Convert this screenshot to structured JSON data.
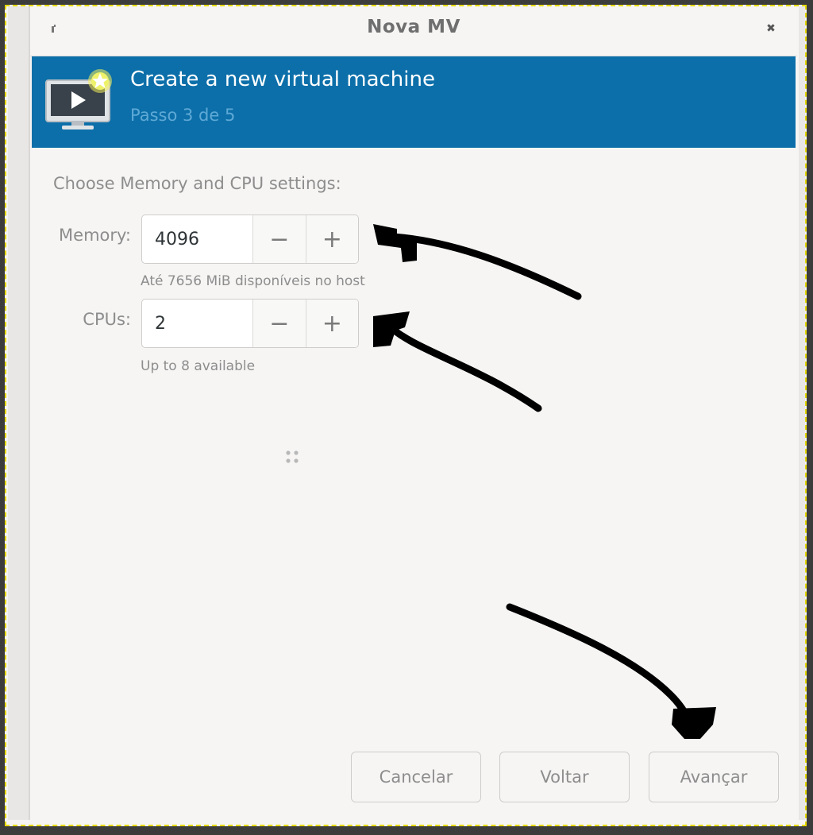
{
  "window": {
    "title": "Nova MV",
    "close_glyph": "✖"
  },
  "banner": {
    "title": "Create a new virtual machine",
    "step": "Passo 3 de 5",
    "icon": "vm-monitor-new-icon",
    "background": "#0c6fa9"
  },
  "content": {
    "section_title": "Choose Memory and CPU settings:",
    "memory": {
      "label": "Memory:",
      "value": "4096",
      "hint": "Até 7656 MiB disponíveis no host"
    },
    "cpus": {
      "label": "CPUs:",
      "value": "2",
      "hint": "Up to 8 available"
    },
    "decrement_glyph": "−",
    "increment_glyph": "+"
  },
  "buttons": {
    "cancel": "Cancelar",
    "back": "Voltar",
    "next": "Avançar"
  },
  "colors": {
    "selection_border": "#e6d800",
    "annotation_ink": "#000000"
  }
}
